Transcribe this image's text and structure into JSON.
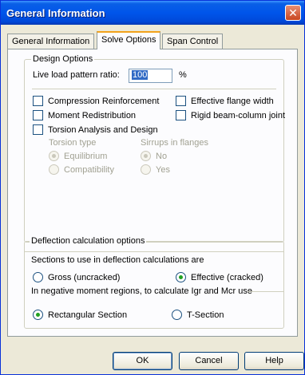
{
  "window": {
    "title": "General Information",
    "close_glyph": "✕"
  },
  "tabs": [
    {
      "label": "General Information"
    },
    {
      "label": "Solve Options"
    },
    {
      "label": "Span Control"
    }
  ],
  "design_options": {
    "legend": "Design Options",
    "live_load_label": "Live load pattern ratio:",
    "live_load_value": "100",
    "live_load_unit": "%",
    "compression_reinforcement": "Compression Reinforcement",
    "effective_flange_width": "Effective flange width",
    "moment_redistribution": "Moment Redistribution",
    "rigid_joint": "Rigid beam-column joint",
    "torsion_analysis": "Torsion Analysis and Design",
    "torsion_type_label": "Torsion type",
    "equilibrium": "Equilibrium",
    "compatibility": "Compatibility",
    "stirrups_label": "Sirrups in flanges",
    "no": "No",
    "yes": "Yes"
  },
  "deflection": {
    "legend": "Deflection calculation options",
    "sections_label": "Sections to use in deflection calculations are",
    "gross": "Gross (uncracked)",
    "effective": "Effective (cracked)",
    "negative_label": "In negative moment regions, to calculate Igr and Mcr use",
    "rectangular": "Rectangular Section",
    "tsection": "T-Section"
  },
  "buttons": {
    "ok": "OK",
    "cancel": "Cancel",
    "help": "Help"
  }
}
